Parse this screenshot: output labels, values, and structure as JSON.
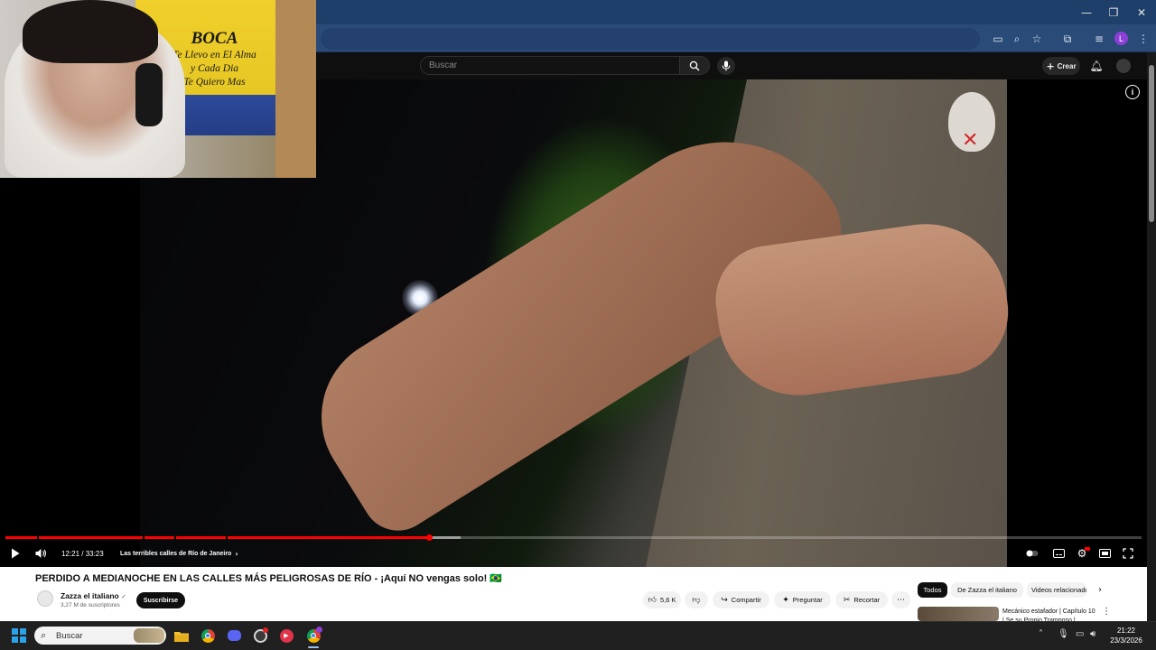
{
  "browser": {
    "window_controls": {
      "minimize": "—",
      "restore": "❐",
      "close": "✕"
    },
    "profile_initial": "L"
  },
  "youtube": {
    "search_placeholder": "Buscar",
    "create_label": "Crear"
  },
  "webcam_flag": {
    "line1": "BOCA",
    "line2": "Te Llevo en El Alma",
    "line3": "y Cada Dia",
    "line4": "Te Quiero Mas"
  },
  "player": {
    "time": "12:21 / 33:23",
    "chapter": "Las terribles calles de Río de Janeiro",
    "progress_fraction": 0.37
  },
  "video": {
    "title": "PERDIDO A MEDIANOCHE EN LAS CALLES MÁS PELIGROSAS DE RÍO - ¡Aquí NO vengas solo! 🇧🇷",
    "channel_name": "Zazza el italiano",
    "subscribers": "3,27 M de suscriptores",
    "subscribe_label": "Suscribirse",
    "likes": "5,6 K",
    "share_label": "Compartir",
    "ask_label": "Preguntar",
    "clip_label": "Recortar"
  },
  "chips": [
    "Todos",
    "De Zazza el italiano",
    "Videos relacionados"
  ],
  "recommendation": {
    "title": "Mecánico estafador | Capítulo 10 | Se su Propio Tramposo |"
  },
  "taskbar": {
    "search_placeholder": "Buscar",
    "time": "21:22",
    "date": "23/3/2026"
  },
  "colors": {
    "accent_red": "#ff0000",
    "title_bar": "#1f3f6b",
    "taskbar": "#202020"
  }
}
